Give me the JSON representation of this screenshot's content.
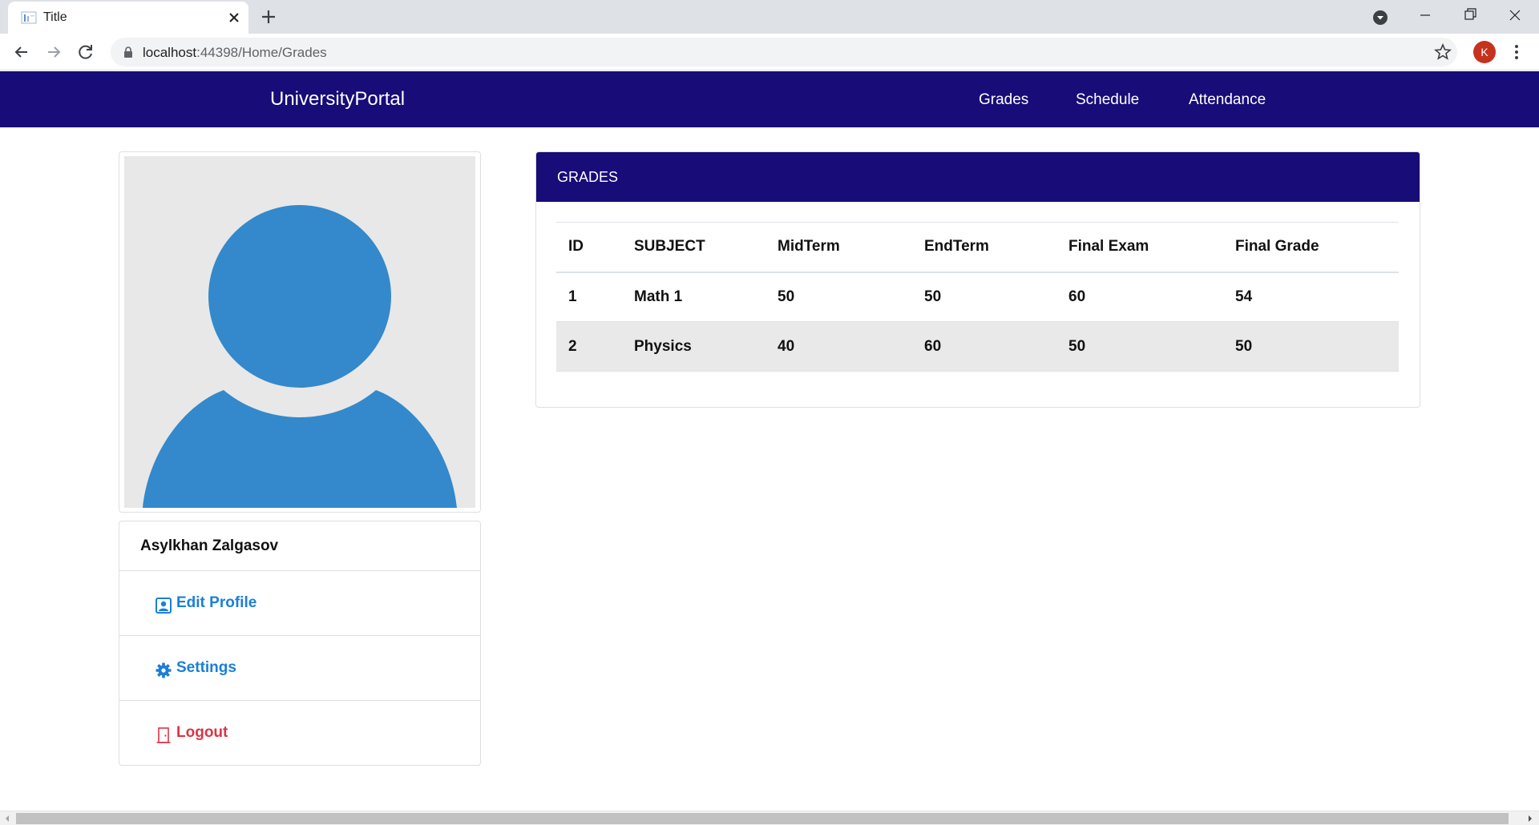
{
  "browser": {
    "tab_title": "Title",
    "url_host": "localhost",
    "url_path": ":44398/Home/Grades",
    "profile_initial": "K",
    "profile_color": "#c5331f"
  },
  "navbar": {
    "brand": "UniversityPortal",
    "links": [
      "Grades",
      "Schedule",
      "Attendance"
    ],
    "background": "#180c78"
  },
  "profile": {
    "name": "Asylkhan Zalgasov",
    "avatar_color": "#3389cb",
    "menu": [
      {
        "label": "Edit Profile",
        "icon": "user-card-icon"
      },
      {
        "label": "Settings",
        "icon": "gear-icon"
      },
      {
        "label": "Logout",
        "icon": "door-exit-icon"
      }
    ]
  },
  "grades": {
    "title": "GRADES",
    "columns": [
      "ID",
      "SUBJECT",
      "MidTerm",
      "EndTerm",
      "Final Exam",
      "Final Grade"
    ],
    "rows": [
      [
        "1",
        "Math 1",
        "50",
        "50",
        "60",
        "54"
      ],
      [
        "2",
        "Physics",
        "40",
        "60",
        "50",
        "50"
      ]
    ]
  }
}
